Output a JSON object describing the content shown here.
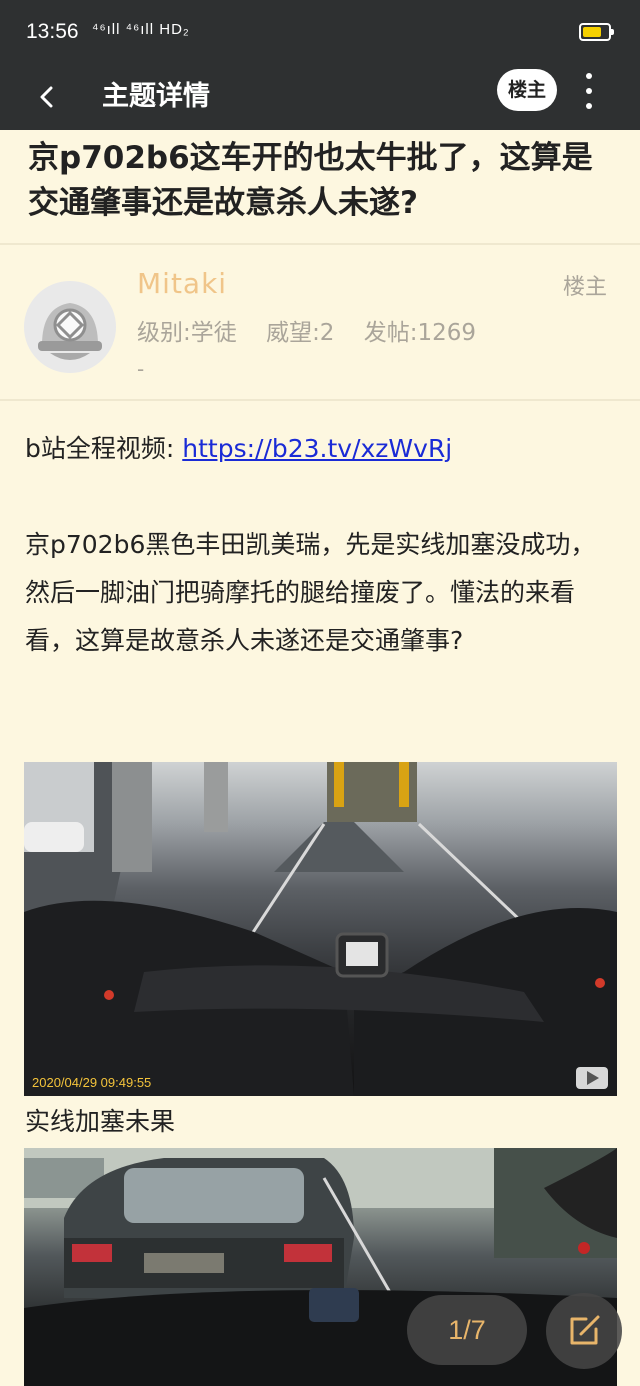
{
  "status_bar": {
    "time": "13:56",
    "network": "⁴⁶ıll ⁴⁶ıll HD₂",
    "battery_level": 0.7
  },
  "app_bar": {
    "back_icon": "chevron-left-icon",
    "title": "主题详情",
    "op_only_label": "楼主",
    "more_icon": "more-vertical-icon"
  },
  "thread": {
    "title": "京p702b6这车开的也太牛批了，这算是交通肇事还是故意杀人未遂?"
  },
  "author": {
    "avatar_icon": "avatar-helmet-icon",
    "name": "Mitaki",
    "level": "级别:学徒",
    "reputation": "威望:2",
    "posts": "发帖:1269",
    "extra": "-",
    "role_tag": "楼主"
  },
  "post": {
    "link_prefix": "b站全程视频: ",
    "link_text": "https://b23.tv/xzWvRj",
    "body": "京p702b6黑色丰田凯美瑞，先是实线加塞没成功，然后一脚油门把骑摩托的腿给撞废了。懂法的来看看，这算是故意杀人未遂还是交通肇事?",
    "image1_timestamp": "2020/04/29 09:49:55",
    "image1_caption": "实线加塞未果"
  },
  "pager": {
    "label": "1/7"
  },
  "colors": {
    "bar_bg": "#2e3031",
    "page_bg": "#fdf7e0",
    "author_name": "#f0c589",
    "meta_text": "#aaa59a",
    "link": "#1a2bd6",
    "pager_text": "#e8b56a"
  }
}
